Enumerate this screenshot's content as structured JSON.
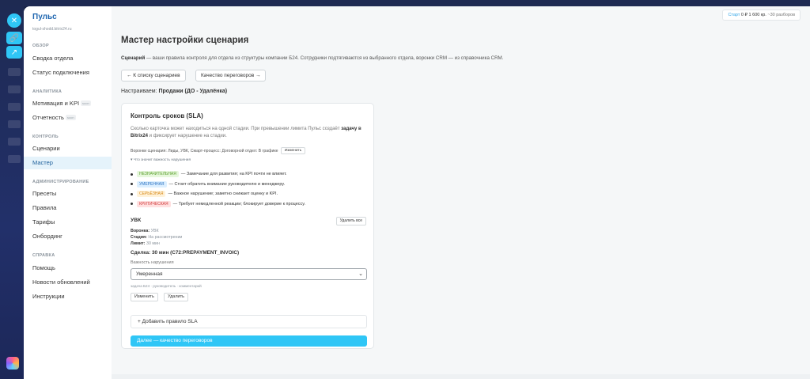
{
  "brand": {
    "title": "Пульс",
    "portal": "togul-shodd.bitrix24.ru"
  },
  "sidebar": {
    "sections": [
      {
        "label": "ОБЗОР",
        "items": [
          {
            "label": "Сводка отдела"
          },
          {
            "label": "Статус подключения"
          }
        ]
      },
      {
        "label": "АНАЛИТИКА",
        "items": [
          {
            "label": "Мотивация и KPI",
            "badge": "soon"
          },
          {
            "label": "Отчетность",
            "badge": "soon"
          }
        ]
      },
      {
        "label": "КОНТРОЛЬ",
        "items": [
          {
            "label": "Сценарии"
          },
          {
            "label": "Мастер"
          }
        ]
      },
      {
        "label": "АДМИНИСТРИРОВАНИЕ",
        "items": [
          {
            "label": "Пресеты"
          },
          {
            "label": "Правила"
          },
          {
            "label": "Тарифы"
          },
          {
            "label": "Онбординг"
          }
        ]
      },
      {
        "label": "СПРАВКА",
        "items": [
          {
            "label": "Помощь"
          },
          {
            "label": "Новости обновлений"
          },
          {
            "label": "Инструкции"
          }
        ]
      }
    ]
  },
  "topbar": {
    "plan": "Старт",
    "balance": "0 ₽",
    "price": "1 600 кр.",
    "reviews": "~30 разборов"
  },
  "page": {
    "title": "Мастер настройки сценария",
    "desc_bold": "Сценарий",
    "desc_rest": " — ваши правила контроля для отдела из структуры компании Б24. Сотрудники подтягиваются из выбранного отдела, воронки CRM — из справочника CRM.",
    "back_button": "← К списку сценариев",
    "next_button": "Качество переговоров →",
    "tune_label": "Настраиваем:",
    "tune_value": "Продажи (ДО - Удалёнка)"
  },
  "card": {
    "title": "Контроль сроков (SLA)",
    "desc_part1": "Сколько карточка может находиться на одной стадии. При превышении лимита Пульс создаёт ",
    "desc_bold": "задачу в Bitrix24",
    "desc_part2": " и фиксирует нарушение на стадии.",
    "funnels": "Воронки сценария: Лиды, УВК, Смарт-процесс: Договорной отдел: В графике",
    "change_button": "Изменить",
    "toggle": "▾ Что значит важность нарушения",
    "severities": [
      {
        "tag": "НЕЗНАЧИТЕЛЬНАЯ",
        "text": "— Замечание для развития; на KPI почти не влияет."
      },
      {
        "tag": "УМЕРЕННАЯ",
        "text": "— Стоит обратить внимание руководителю и менеджеру."
      },
      {
        "tag": "СЕРЬЁЗНАЯ",
        "text": "— Важное нарушение; заметно снижает оценку и KPI."
      },
      {
        "tag": "КРИТИЧЕСКАЯ",
        "text": "— Требует немедленной реакции; блокирует доверие к процессу."
      }
    ],
    "rule": {
      "title": "УВК",
      "delete_all": "Удалить все",
      "funnel_label": "Воронка:",
      "funnel_value": "УВК",
      "stage_label": "Стадия:",
      "stage_value": "На рассмотрении",
      "limit_label": "Лимит:",
      "limit_value": "30 мин",
      "deal": "Сделка: 30 мин (C72:PREPAYMENT_INVOIC)",
      "severity_label": "Важность нарушения",
      "severity_value": "Умеренная",
      "hint": "задача Б24 · руководитель · комментарий",
      "edit_button": "Изменить",
      "delete_button": "Удалить"
    },
    "add_rule": "+ Добавить правило SLA",
    "next": "Далее — качество переговоров"
  }
}
